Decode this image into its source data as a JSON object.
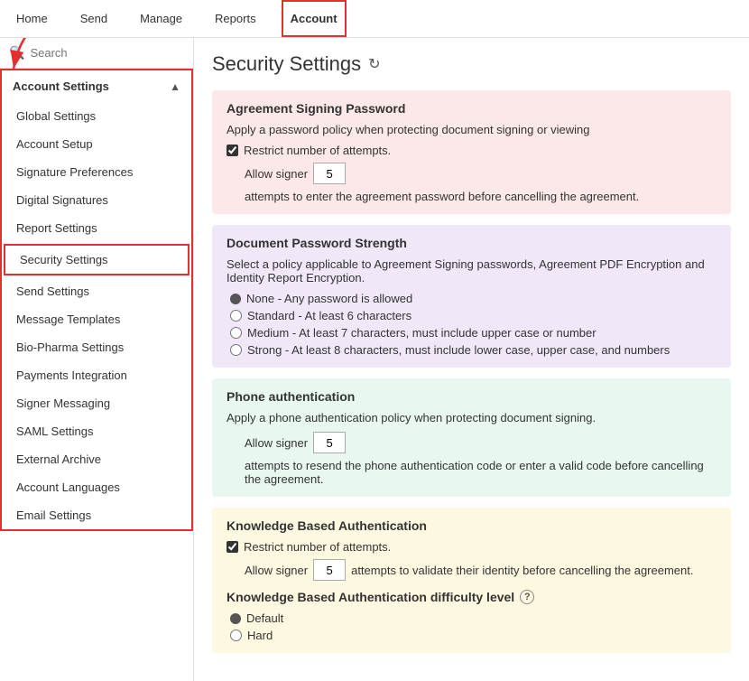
{
  "nav": {
    "items": [
      {
        "label": "Home",
        "active": false
      },
      {
        "label": "Send",
        "active": false
      },
      {
        "label": "Manage",
        "active": false
      },
      {
        "label": "Reports",
        "active": false
      },
      {
        "label": "Account",
        "active": true
      }
    ]
  },
  "sidebar": {
    "search_placeholder": "Search",
    "section_label": "Account Settings",
    "items": [
      {
        "label": "Global Settings",
        "active": false
      },
      {
        "label": "Account Setup",
        "active": false
      },
      {
        "label": "Signature Preferences",
        "active": false
      },
      {
        "label": "Digital Signatures",
        "active": false
      },
      {
        "label": "Report Settings",
        "active": false
      },
      {
        "label": "Security Settings",
        "active": true
      },
      {
        "label": "Send Settings",
        "active": false
      },
      {
        "label": "Message Templates",
        "active": false
      },
      {
        "label": "Bio-Pharma Settings",
        "active": false
      },
      {
        "label": "Payments Integration",
        "active": false
      },
      {
        "label": "Signer Messaging",
        "active": false
      },
      {
        "label": "SAML Settings",
        "active": false
      },
      {
        "label": "External Archive",
        "active": false
      },
      {
        "label": "Account Languages",
        "active": false
      },
      {
        "label": "Email Settings",
        "active": false
      }
    ]
  },
  "main": {
    "page_title": "Security Settings",
    "refresh_icon": "↻",
    "sections": {
      "agreement_signing": {
        "title": "Agreement Signing Password",
        "subtitle": "Apply a password policy when protecting document signing or viewing",
        "checkbox_label": "Restrict number of attempts.",
        "checkbox_checked": true,
        "attempts_label_before": "Allow signer",
        "attempts_value": "5",
        "attempts_label_after": "attempts to enter the agreement password before cancelling the agreement."
      },
      "document_password": {
        "title": "Document Password Strength",
        "subtitle": "Select a policy applicable to Agreement Signing passwords, Agreement PDF Encryption and Identity Report Encryption.",
        "options": [
          {
            "label": "None - Any password is allowed",
            "type": "filled"
          },
          {
            "label": "Standard - At least 6 characters",
            "type": "radio"
          },
          {
            "label": "Medium - At least 7 characters, must include upper case or number",
            "type": "radio"
          },
          {
            "label": "Strong - At least 8 characters, must include lower case, upper case, and numbers",
            "type": "radio"
          }
        ]
      },
      "phone_auth": {
        "title": "Phone authentication",
        "subtitle": "Apply a phone authentication policy when protecting document signing.",
        "attempts_label_before": "Allow signer",
        "attempts_value": "5",
        "attempts_label_after": "attempts to resend the phone authentication code or enter a valid code before cancelling the agreement."
      },
      "kba": {
        "title": "Knowledge Based Authentication",
        "checkbox_label": "Restrict number of attempts.",
        "checkbox_checked": true,
        "attempts_label_before": "Allow signer",
        "attempts_value": "5",
        "attempts_label_after": "attempts to validate their identity before cancelling the agreement.",
        "difficulty_label": "Knowledge Based Authentication difficulty level",
        "difficulty_options": [
          {
            "label": "Default",
            "type": "filled"
          },
          {
            "label": "Hard",
            "type": "radio"
          }
        ]
      }
    }
  }
}
